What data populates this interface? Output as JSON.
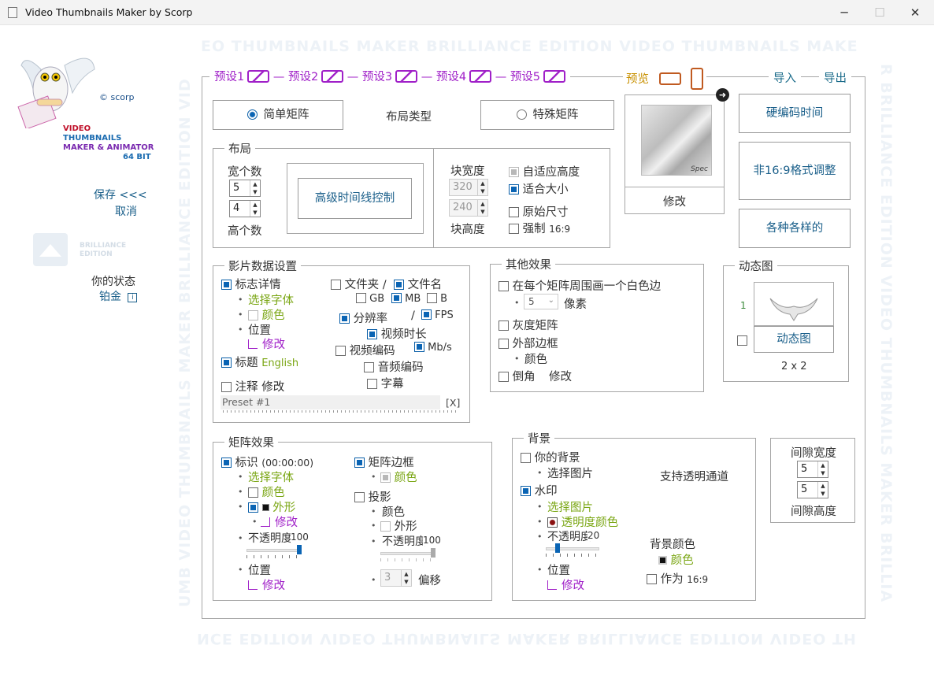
{
  "window": {
    "title": "Video Thumbnails Maker by Scorp",
    "minimize": "─",
    "maximize": "☐",
    "close": "✕"
  },
  "watermark": {
    "top": "EO THUMBNAILS MAKER  BRILLIANCE EDITION  VIDEO THUMBNAILS MAKE",
    "bottom": "NCE EDITION  VIDEO THUMBNAILS MAKER  BRILLIANCE EDITION  VIDEO TH",
    "left": "UMB   VIDEO THUMBNAILS MAKER   BRILLIANCE EDITION   VID",
    "right": "R   BRILLIANCE EDITION   VIDEO THUMBNAILS MAKER   BRILLIA"
  },
  "sidebar": {
    "copyright": "© scorp",
    "logo_lines": [
      "VIDEO",
      "THUMBNAILS",
      "MAKER & ANIMATOR",
      "64 BIT"
    ],
    "save": "保存 <<<",
    "cancel": "取消",
    "badge_line1": "BRILLIANCE",
    "badge_line2": "EDITION",
    "status_label": "你的状态",
    "status_value": "铂金"
  },
  "presets": [
    "预设1",
    "预设2",
    "预设3",
    "预设4",
    "预设5"
  ],
  "toolbar": {
    "preview": "预览",
    "import": "导入",
    "export": "导出"
  },
  "layout_type": {
    "simple": "简单矩阵",
    "label": "布局类型",
    "special": "特殊矩阵"
  },
  "preview_box": {
    "modify": "修改",
    "spec": "Spec"
  },
  "right_buttons": {
    "hardcode": "硬编码时间",
    "non169": "非16:9格式调整",
    "various": "各种各样的"
  },
  "layout": {
    "legend": "布局",
    "cols_label": "宽个数",
    "cols": "5",
    "rows": "4",
    "rows_label": "高个数",
    "timeline": "高级时间线控制",
    "block_width_label": "块宽度",
    "block_width": "320",
    "block_height": "240",
    "block_height_label": "块高度",
    "auto_height": "自适应高度",
    "fit_size": "适合大小",
    "original": "原始尺寸",
    "force169": "强制",
    "force169_val": "16:9"
  },
  "movie": {
    "legend": "影片数据设置",
    "logo_detail": "标志详情",
    "choose_font": "选择字体",
    "color": "颜色",
    "position": "位置",
    "modify": "修改",
    "title": "标题",
    "title_lang": "English",
    "note": "注释 修改",
    "folder": "文件夹 /",
    "filename": "文件名",
    "gb": "GB",
    "mb": "MB",
    "b": "B",
    "resolution": "分辨率",
    "slash": "/",
    "fps": "FPS",
    "duration": "视频时长",
    "vcodec": "视频编码",
    "mbs": "Mb/s",
    "acodec": "音频编码",
    "subtitle": "字幕",
    "preset_name": "Preset #1",
    "preset_close": "[X]"
  },
  "other": {
    "legend": "其他效果",
    "white_border": "在每个矩阵周围画一个白色边",
    "px_val": "5",
    "px_label": "像素",
    "gray": "灰度矩阵",
    "outer_border": "外部边框",
    "color": "颜色",
    "rounded": "倒角",
    "rounded_modify": "修改"
  },
  "animated": {
    "legend": "动态图",
    "num": "1",
    "button": "动态图",
    "grid": "2 x 2"
  },
  "matrix": {
    "legend": "矩阵效果",
    "mark": "标识",
    "mark_time": "(00:00:00)",
    "choose_font": "选择字体",
    "color": "颜色",
    "shape": "外形",
    "modify": "修改",
    "opacity": "不透明度",
    "opacity_val": "100",
    "position": "位置",
    "pos_modify": "修改",
    "border": "矩阵边框",
    "border_color": "颜色",
    "shadow": "投影",
    "shadow_color": "颜色",
    "shadow_shape": "外形",
    "shadow_opacity": "不透明度",
    "shadow_opacity_val": "100",
    "offset_val": "3",
    "offset": "偏移",
    "opacity_level": 1.0,
    "shadow_opacity_level": 1.0
  },
  "background": {
    "legend": "背景",
    "your_bg": "你的背景",
    "choose_img": "选择图片",
    "alpha": "支持透明通道",
    "watermark": "水印",
    "wm_choose": "选择图片",
    "wm_opacity_color": "透明度颜色",
    "wm_opacity": "不透明度",
    "wm_opacity_val": "20",
    "position": "位置",
    "pos_modify": "修改",
    "bg_color_label": "背景颜色",
    "bg_color": "颜色",
    "as169": "作为",
    "as169_val": "16:9",
    "wm_opacity_level": 0.2
  },
  "gap": {
    "width_label": "间隙宽度",
    "w": "5",
    "h": "5",
    "height_label": "间隙高度"
  }
}
